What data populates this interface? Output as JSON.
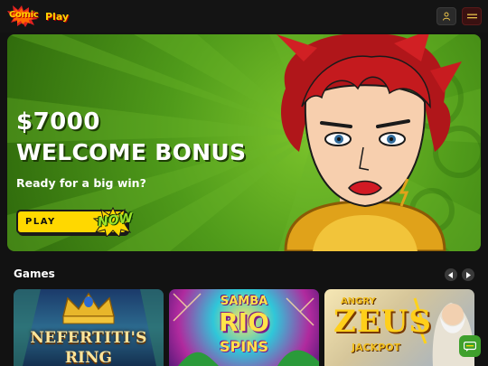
{
  "header": {
    "logo_word_1": "Comic",
    "logo_word_2": "Play",
    "user_icon": "user-icon",
    "menu_icon": "hamburger-menu-icon"
  },
  "banner": {
    "amount": "$7000",
    "title": "WELCOME BONUS",
    "subtitle": "Ready for a big win?",
    "play_label": "PLAY",
    "now_label": "NOW"
  },
  "games": {
    "title": "Games",
    "prev_icon": "chevron-left-icon",
    "next_icon": "chevron-right-icon",
    "cards": [
      {
        "line1": "NEFERTITI'S",
        "line2": "RING"
      },
      {
        "line1": "SAMBA",
        "line2": "RIO",
        "line3": "SPINS"
      },
      {
        "line1": "ANGRY",
        "line2": "ZEUS",
        "line3": "JACKPOT"
      }
    ]
  },
  "chat": {
    "icon": "chat-icon"
  },
  "colors": {
    "accent_yellow": "#ffd800",
    "banner_green": "#5aa51e",
    "header_bg": "#141414",
    "page_bg": "#121212"
  }
}
